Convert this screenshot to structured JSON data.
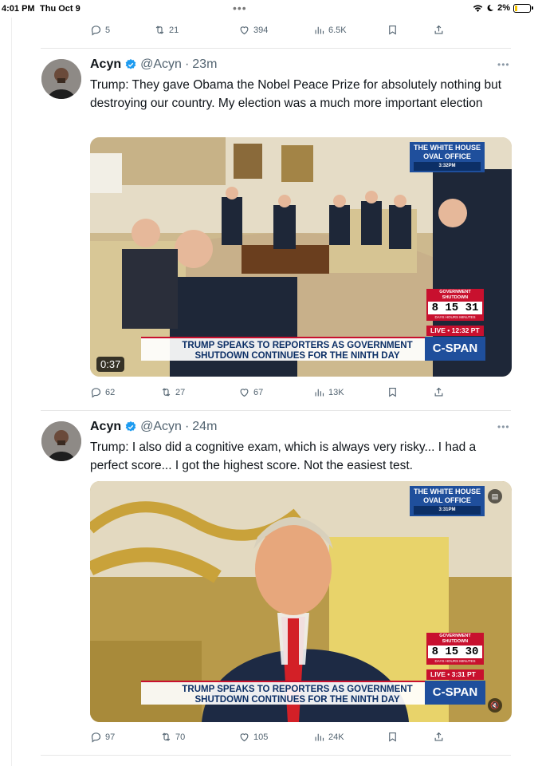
{
  "status_bar": {
    "time": "4:01 PM",
    "date": "Thu Oct 9",
    "battery": "2%"
  },
  "top_actions": {
    "replies": "5",
    "reposts": "21",
    "likes": "394",
    "views": "6.5K"
  },
  "tweets": [
    {
      "name": "Acyn",
      "handle": "@Acyn",
      "time": "23m",
      "text": "Trump: They gave Obama the Nobel Peace Prize for absolutely nothing but destroying our country. My election was a much more important election",
      "media": {
        "wh_line1": "THE WHITE HOUSE",
        "wh_line2": "OVAL OFFICE",
        "wh_time": "3:32PM",
        "shutdown_label": "GOVERNMENT SHUTDOWN",
        "shutdown_count": "8 15 31",
        "shutdown_units": "DAYS HOURS MINUTES",
        "live": "LIVE • 12:32 PT",
        "chyron_1": "TRUMP SPEAKS TO REPORTERS AS GOVERNMENT",
        "chyron_2": "SHUTDOWN CONTINUES FOR THE NINTH DAY",
        "network": "C-SPAN",
        "duration": "0:37"
      },
      "actions": {
        "replies": "62",
        "reposts": "27",
        "likes": "67",
        "views": "13K"
      }
    },
    {
      "name": "Acyn",
      "handle": "@Acyn",
      "time": "24m",
      "text": "Trump: I also did a cognitive exam, which is always very risky... I had a perfect score... I got the highest score. Not the easiest test.",
      "media": {
        "wh_line1": "THE WHITE HOUSE",
        "wh_line2": "OVAL OFFICE",
        "wh_time": "3:31PM",
        "shutdown_label": "GOVERNMENT SHUTDOWN",
        "shutdown_count": "8 15 30",
        "shutdown_units": "DAYS HOURS MINUTES",
        "live": "LIVE • 3:31 PT",
        "chyron_1": "TRUMP SPEAKS TO REPORTERS AS GOVERNMENT",
        "chyron_2": "SHUTDOWN CONTINUES FOR THE NINTH DAY",
        "network": "C-SPAN"
      },
      "actions": {
        "replies": "97",
        "reposts": "70",
        "likes": "105",
        "views": "24K"
      }
    }
  ],
  "colors": {
    "cspan_blue": "#1f4f9c",
    "cspan_red": "#c8102e",
    "verified": "#1d9bf0",
    "muted": "#536471"
  }
}
